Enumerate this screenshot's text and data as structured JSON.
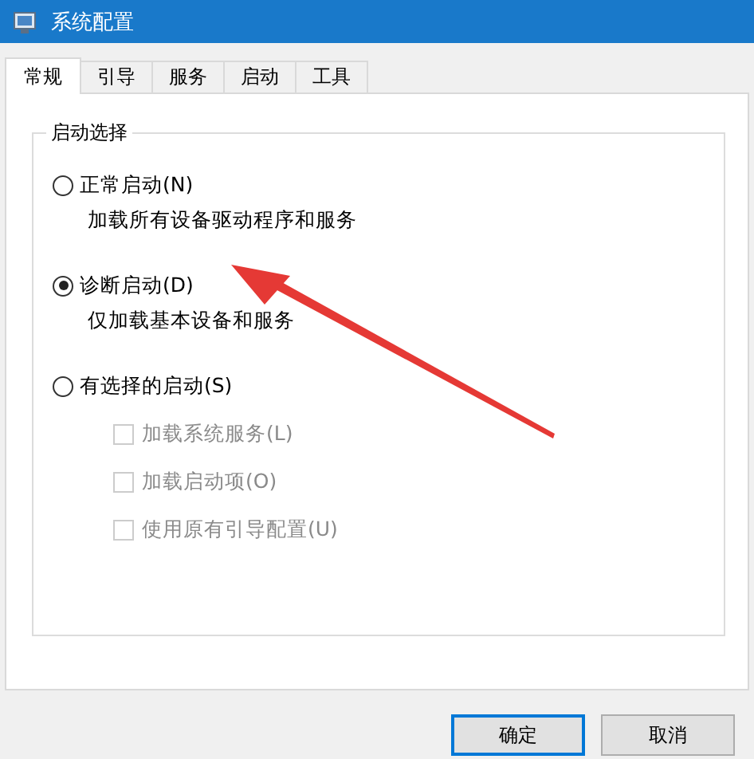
{
  "window": {
    "title": "系统配置"
  },
  "tabs": [
    {
      "label": "常规",
      "selected": true
    },
    {
      "label": "引导",
      "selected": false
    },
    {
      "label": "服务",
      "selected": false
    },
    {
      "label": "启动",
      "selected": false
    },
    {
      "label": "工具",
      "selected": false
    }
  ],
  "startup_group": {
    "title": "启动选择",
    "options": [
      {
        "label": "正常启动(N)",
        "description": "加载所有设备驱动程序和服务",
        "selected": false
      },
      {
        "label": "诊断启动(D)",
        "description": "仅加载基本设备和服务",
        "selected": true
      },
      {
        "label": "有选择的启动(S)",
        "selected": false,
        "checkboxes": [
          {
            "label": "加载系统服务(L)",
            "checked": false,
            "disabled": true
          },
          {
            "label": "加载启动项(O)",
            "checked": false,
            "disabled": true
          },
          {
            "label": "使用原有引导配置(U)",
            "checked": false,
            "disabled": true
          }
        ]
      }
    ]
  },
  "annotations": [
    {
      "kind": "arrow"
    }
  ],
  "buttons": [
    {
      "label": "确定",
      "selected": true
    },
    {
      "label": "取消",
      "selected": false
    }
  ]
}
